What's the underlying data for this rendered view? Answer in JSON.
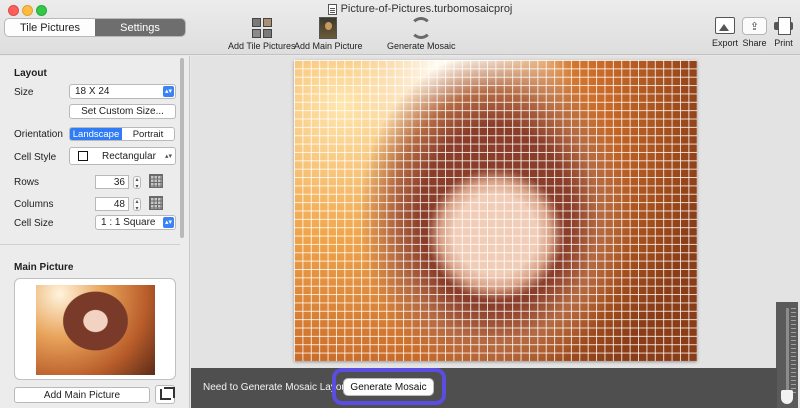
{
  "window": {
    "title": "Picture-of-Pictures.turbomosaicproj"
  },
  "tabs": [
    {
      "label": "Tile Pictures",
      "active": false
    },
    {
      "label": "Settings",
      "active": true
    }
  ],
  "toolbar": {
    "add_tile_pictures": "Add Tile Pictures",
    "add_main_picture": "Add Main Picture",
    "generate_mosaic": "Generate Mosaic",
    "export": "Export",
    "share": "Share",
    "print": "Print"
  },
  "layout": {
    "section_title": "Layout",
    "size_label": "Size",
    "size_value": "18 X 24",
    "custom_size_button": "Set Custom Size...",
    "orientation_label": "Orientation",
    "orientation_options": [
      "Landscape",
      "Portrait"
    ],
    "orientation_selected": "Landscape",
    "cell_style_label": "Cell Style",
    "cell_style_value": "Rectangular",
    "rows_label": "Rows",
    "rows_value": "36",
    "columns_label": "Columns",
    "columns_value": "48",
    "cell_size_label": "Cell Size",
    "cell_size_value": "1 : 1 Square"
  },
  "main_picture": {
    "section_title": "Main Picture",
    "add_button": "Add Main Picture"
  },
  "bottom_bar": {
    "notice": "Need to Generate Mosaic Layout",
    "generate_button": "Generate Mosaic"
  },
  "colors": {
    "accent": "#2f7cf6",
    "highlight": "#5b4de0",
    "bottom_bar": "#4f4f4f"
  }
}
